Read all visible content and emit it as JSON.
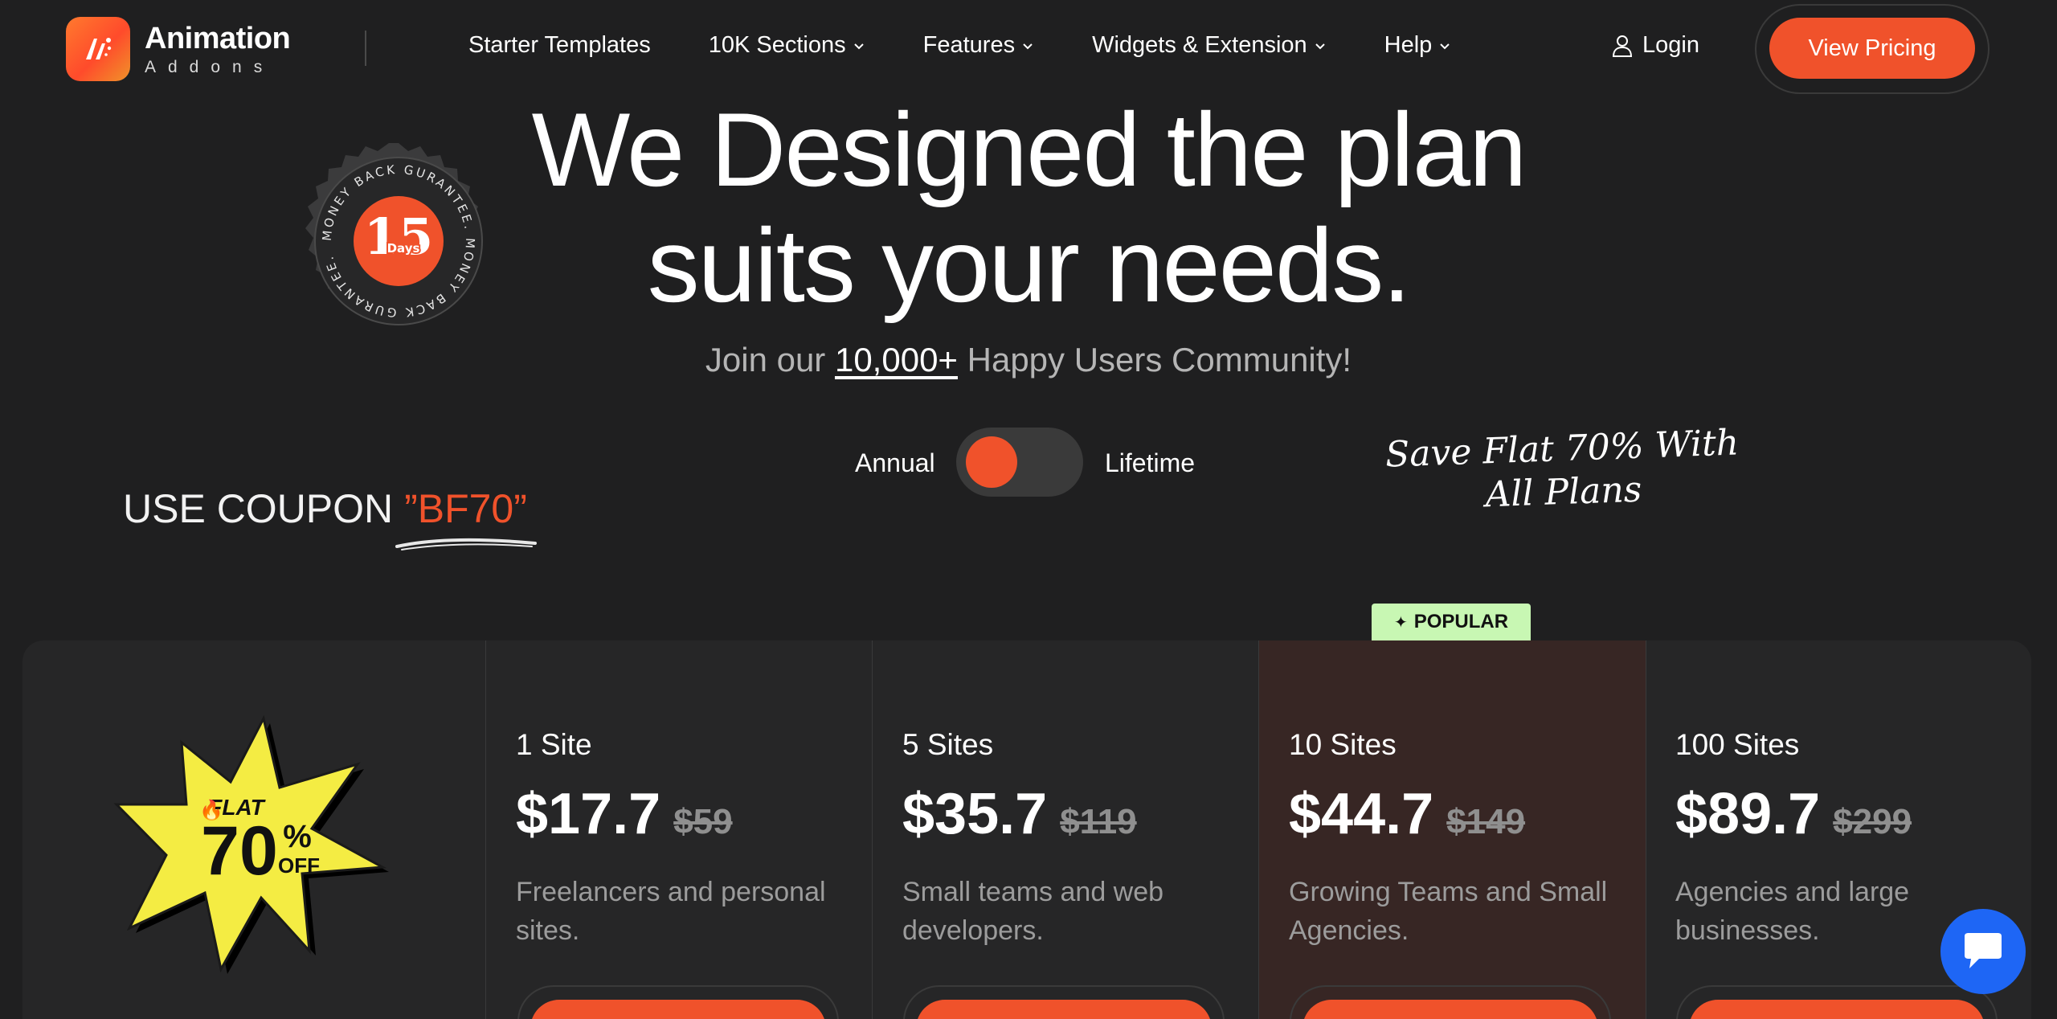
{
  "brand": {
    "name": "Animation",
    "sub": "Addons"
  },
  "nav": {
    "items": [
      {
        "label": "Starter Templates",
        "dropdown": false
      },
      {
        "label": "10K Sections",
        "dropdown": true
      },
      {
        "label": "Features",
        "dropdown": true
      },
      {
        "label": "Widgets & Extension",
        "dropdown": true
      },
      {
        "label": "Help",
        "dropdown": true
      }
    ],
    "login": "Login",
    "cta": "View Pricing"
  },
  "hero": {
    "title_line1": "We Designed the plan",
    "title_line2": "suits your needs.",
    "sub_before": "Join our ",
    "sub_highlight": "10,000+",
    "sub_after": " Happy Users Community!"
  },
  "badge": {
    "ring_text": "MONEY BACK GURANTEE. MONEY BACK GURANTEE.",
    "number": "15",
    "unit": "Days"
  },
  "billing": {
    "left": "Annual",
    "right": "Lifetime",
    "selected": "Annual"
  },
  "coupon": {
    "prefix": "USE COUPON ",
    "code": "”BF70”"
  },
  "save_note": {
    "line1": "Save Flat 70% With",
    "line2": "All Plans"
  },
  "offer_burst": {
    "flat": "FLAT",
    "percent": "70",
    "percent_sign": "%",
    "off": "OFF"
  },
  "popular_label": "POPULAR",
  "plans": [
    {
      "name": "1 Site",
      "price": "$17.7",
      "was": "$59",
      "desc": "Freelancers and personal sites."
    },
    {
      "name": "5 Sites",
      "price": "$35.7",
      "was": "$119",
      "desc": "Small teams and web developers."
    },
    {
      "name": "10 Sites",
      "price": "$44.7",
      "was": "$149",
      "desc": "Growing Teams and Small Agencies."
    },
    {
      "name": "100 Sites",
      "price": "$89.7",
      "was": "$299",
      "desc": "Agencies and large businesses."
    }
  ],
  "colors": {
    "accent": "#f0522b",
    "background": "#1f1f20",
    "popular_bg": "#c8f7b3",
    "highlight_col": "#372624",
    "chat": "#1e66f5"
  }
}
